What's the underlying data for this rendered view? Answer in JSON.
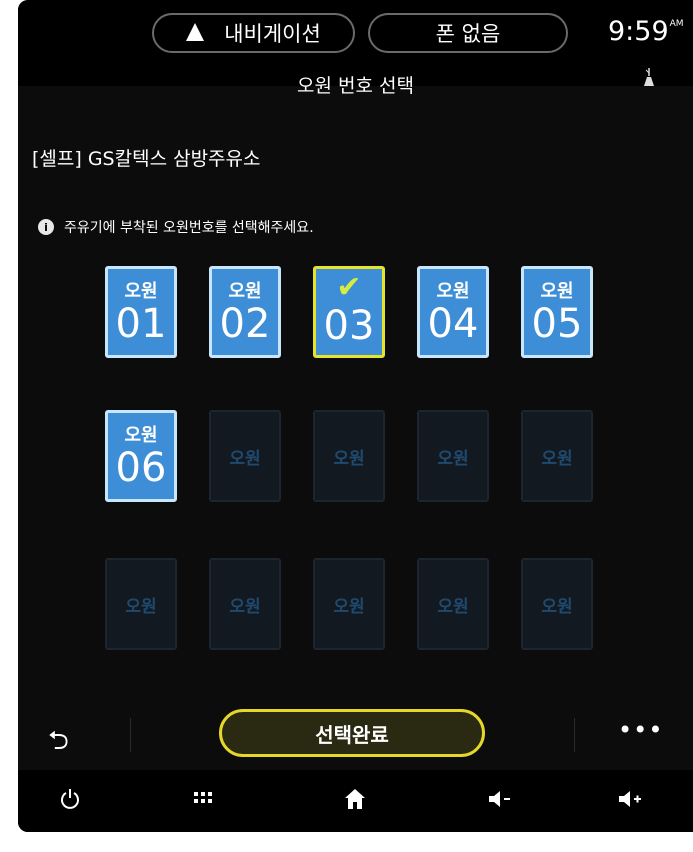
{
  "status_bar": {
    "navigation_label": "내비게이션",
    "phone_label": "폰 없음",
    "time": "9:59",
    "ampm": "AM"
  },
  "page": {
    "title": "오원 번호 선택",
    "station": "[셀프] GS칼텍스 삼방주유소",
    "instruction": "주유기에 부착된 오원번호를 선택해주세요."
  },
  "pump_grid": {
    "label": "오원",
    "selected": "03",
    "active_tiles": [
      "01",
      "02",
      "03",
      "04",
      "05",
      "06"
    ]
  },
  "actions": {
    "confirm_label": "선택완료",
    "more_label": "•••"
  },
  "icons": {
    "navigation": "navigation-arrow-icon",
    "signal": "signal-icon",
    "info": "info-icon",
    "check": "check-icon",
    "back": "back-icon",
    "power": "power-icon",
    "apps": "apps-grid-icon",
    "home": "home-icon",
    "volume_down": "volume-down-icon",
    "volume_up": "volume-up-icon"
  },
  "colors": {
    "tile_active": "#3d8ed6",
    "tile_selected_border": "#e6e32a",
    "confirm_border": "#e6d829"
  }
}
